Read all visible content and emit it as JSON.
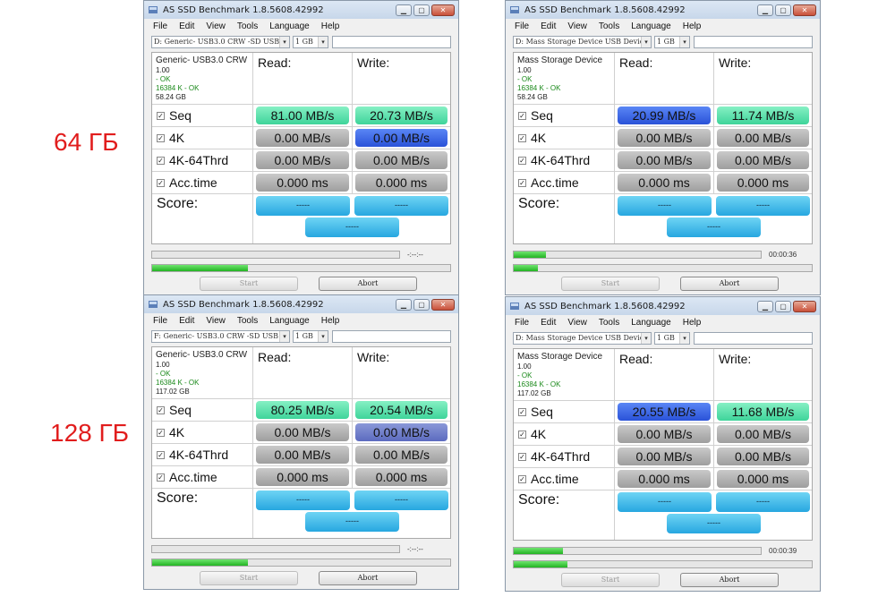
{
  "labels": {
    "top": "64 ГБ",
    "bottom": "128 ГБ"
  },
  "colors": {
    "label": "#e11d1d",
    "green": "#3ed49a",
    "blue": "#2a52d8",
    "gray": "#9e9e9e",
    "score": "#27a7e0"
  },
  "common": {
    "title": "AS SSD Benchmark 1.8.5608.42992",
    "menu": [
      "File",
      "Edit",
      "View",
      "Tools",
      "Language",
      "Help"
    ],
    "size_select": "1 GB",
    "read_hdr": "Read:",
    "write_hdr": "Write:",
    "rows": [
      "Seq",
      "4K",
      "4K-64Thrd",
      "Acc.time"
    ],
    "score_label": "Score:",
    "score_placeholder": "-----",
    "start": "Start",
    "abort": "Abort",
    "min_icon": "minimize-icon",
    "max_icon": "maximize-icon",
    "close_icon": "close-icon"
  },
  "windows": [
    {
      "drive": "D: Generic- USB3.0 CRW   -SD USB",
      "device": "Generic- USB3.0 CRW",
      "info": [
        "1.00",
        "- OK",
        "16384 K - OK",
        "58.24 GB"
      ],
      "read": [
        "81.00 MB/s",
        "0.00 MB/s",
        "0.00 MB/s",
        "0.000 ms"
      ],
      "write": [
        "20.73 MB/s",
        "0.00 MB/s",
        "0.00 MB/s",
        "0.000 ms"
      ],
      "time1": "-:--:--",
      "time2": "",
      "progress1": 0,
      "progress2": 0.32
    },
    {
      "drive": "D: Mass Storage Device USB Device",
      "device": "Mass Storage Device",
      "info": [
        "1.00",
        "- OK",
        "16384 K - OK",
        "58.24 GB"
      ],
      "read": [
        "20.99 MB/s",
        "0.00 MB/s",
        "0.00 MB/s",
        "0.000 ms"
      ],
      "write": [
        "11.74 MB/s",
        "0.00 MB/s",
        "0.00 MB/s",
        "0.000 ms"
      ],
      "time1": "00:00:36",
      "time2": "",
      "progress1": 0.13,
      "progress2": 0.08
    },
    {
      "drive": "F: Generic- USB3.0 CRW   -SD USB",
      "device": "Generic- USB3.0 CRW",
      "info": [
        "1.00",
        "- OK",
        "16384 K - OK",
        "117.02 GB"
      ],
      "read": [
        "80.25 MB/s",
        "0.00 MB/s",
        "0.00 MB/s",
        "0.000 ms"
      ],
      "write": [
        "20.54 MB/s",
        "0.00 MB/s",
        "0.00 MB/s",
        "0.000 ms"
      ],
      "time1": "-:--:--",
      "time2": "",
      "progress1": 0,
      "progress2": 0.32
    },
    {
      "drive": "D: Mass Storage Device USB Device",
      "device": "Mass Storage Device",
      "info": [
        "1.00",
        "- OK",
        "16384 K - OK",
        "117.02 GB"
      ],
      "read": [
        "20.55 MB/s",
        "0.00 MB/s",
        "0.00 MB/s",
        "0.000 ms"
      ],
      "write": [
        "11.68 MB/s",
        "0.00 MB/s",
        "0.00 MB/s",
        "0.000 ms"
      ],
      "time1": "00:00:39",
      "time2": "",
      "progress1": 0.2,
      "progress2": 0.18
    }
  ]
}
